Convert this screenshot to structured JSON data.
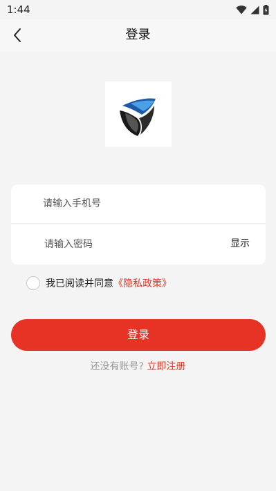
{
  "status_bar": {
    "time": "1:44",
    "icons": [
      "wifi-icon",
      "signal-icon",
      "battery-icon"
    ]
  },
  "header": {
    "back_icon": "chevron-left-icon",
    "title": "登录"
  },
  "logo": {
    "icon": "shield-logo"
  },
  "form": {
    "phone_placeholder": "请输入手机号",
    "phone_value": "",
    "password_placeholder": "请输入密码",
    "password_value": "",
    "show_label": "显示"
  },
  "agreement": {
    "checked": false,
    "text": "我已阅读并同意",
    "link": "《隐私政策》"
  },
  "login_button": {
    "label": "登录"
  },
  "register": {
    "question": "还没有账号?",
    "link": "立即注册"
  },
  "colors": {
    "accent": "#e63325",
    "background": "#f4f4f4",
    "card": "#ffffff"
  }
}
